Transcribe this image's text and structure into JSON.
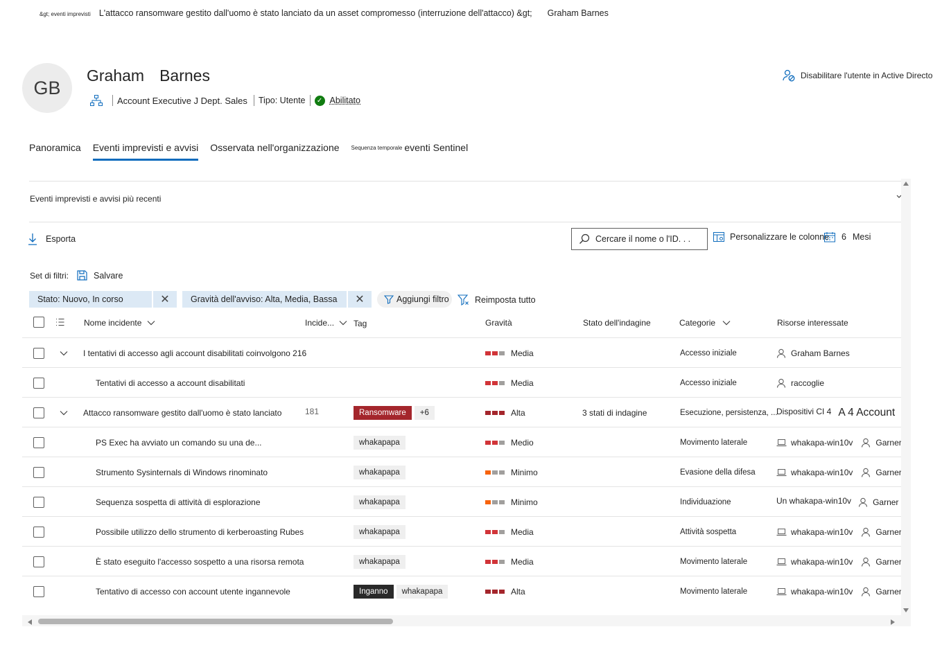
{
  "breadcrumb": {
    "parent": "&gt; eventi imprevisti",
    "incident": "L'attacco ransomware gestito dall'uomo è stato lanciato da un asset compromesso (interruzione dell'attacco) &gt;",
    "current": "Graham Barnes"
  },
  "user": {
    "initials": "GB",
    "first_name": "Graham",
    "last_name": "Barnes",
    "title": "Account Executive J Dept. Sales",
    "type": "Tipo: Utente",
    "status": "Abilitato"
  },
  "actions": {
    "disable_user": "Disabilitare l'utente in Active Directory"
  },
  "tabs": [
    {
      "label": "Panoramica"
    },
    {
      "label": "Eventi imprevisti e avvisi",
      "active": true
    },
    {
      "label": "Osservata nell'organizzazione"
    },
    {
      "small": "Sequenza temporale",
      "label": "eventi Sentinel"
    }
  ],
  "section_title": "Eventi imprevisti e avvisi più recenti",
  "toolbar": {
    "export": "Esporta",
    "search_placeholder": "Cercare il nome o l'ID. . .",
    "customize_columns": "Personalizzare le colonne",
    "months_value": "6",
    "months_label": "Mesi"
  },
  "filters": {
    "set_label": "Set di filtri:",
    "save": "Salvare",
    "chips": [
      "Stato: Nuovo, In corso",
      "Gravità dell'avviso: Alta, Media, Bassa"
    ],
    "add_filter": "Aggiungi filtro",
    "reset_all": "Reimposta tutto"
  },
  "columns": {
    "name": "Nome incidente",
    "id": "Incide...",
    "tag": "Tag",
    "severity": "Gravità",
    "investigation": "Stato dell'indagine",
    "categories": "Categorie",
    "assets": "Risorse interessate"
  },
  "colors": {
    "accent": "#0f6cbd",
    "sev_high": "#a4262c",
    "sev_medium": "#d13438",
    "sev_low": "#f7630c",
    "sev_off": "#a19f9d"
  },
  "rows": [
    {
      "name": "I tentativi di accesso agli account disabilitati coinvolgono 216",
      "expand": true,
      "severity": "Media",
      "category": "Accesso iniziale",
      "asset_user": "Graham Barnes"
    },
    {
      "name": "Tentativi di accesso a account disabilitati",
      "child": true,
      "severity": "Media",
      "category": "Accesso iniziale",
      "asset_user": "raccoglie"
    },
    {
      "name": "Attacco ransomware gestito dall'uomo è stato lanciato",
      "expand": true,
      "id": "181",
      "tag": "Ransomware",
      "tag_more": "+6",
      "severity": "Alta",
      "investigation": "3 stati di indagine",
      "category": "Esecuzione, persistenza, ...",
      "asset_text": "Dispositivi CI 4",
      "asset_big": "A 4 Account"
    },
    {
      "name": "PS Exec ha avviato un comando su una de...",
      "child": true,
      "tag": "whakapapa",
      "severity": "Medio",
      "category": "Movimento laterale",
      "asset_device": "whakapa-win10v",
      "asset_user": "Garner"
    },
    {
      "name": "Strumento Sysinternals di Windows rinominato",
      "child": true,
      "tag": "whakapapa",
      "severity": "Minimo",
      "category": "Evasione della difesa",
      "asset_device": "whakapa-win10v",
      "asset_user": "Garner"
    },
    {
      "name": "Sequenza sospetta di attività di esplorazione",
      "child": true,
      "tag": "whakapapa",
      "severity": "Minimo",
      "category": "Individuazione",
      "asset_text": "Un whakapa-win10v",
      "asset_user": "Garner"
    },
    {
      "name": "Possibile utilizzo dello strumento di kerberoasting Rubes",
      "child": true,
      "tag": "whakapapa",
      "severity": "Media",
      "category": "Attività sospetta",
      "asset_device": "whakapa-win10v",
      "asset_user": "Garner"
    },
    {
      "name": "È stato eseguito l'accesso sospetto a una risorsa remota",
      "child": true,
      "tag": "whakapapa",
      "severity": "Media",
      "category": "Movimento laterale",
      "asset_device": "whakapa-win10v",
      "asset_user": "Garner"
    },
    {
      "name": "Tentativo di accesso con account utente ingannevole",
      "child": true,
      "tag": "Inganno",
      "tag2": "whakapapa",
      "severity": "Alta",
      "category": "Movimento laterale",
      "asset_device": "whakapa-win10v",
      "asset_user": "Garner"
    }
  ]
}
